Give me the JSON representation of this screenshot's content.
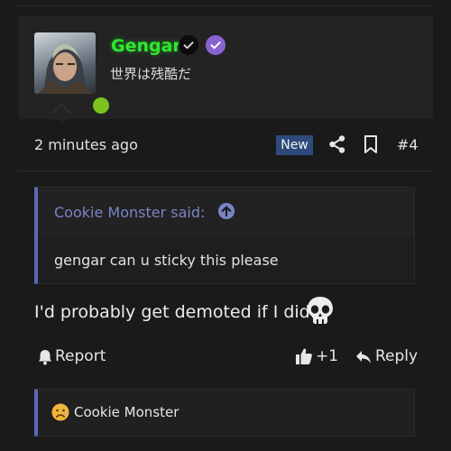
{
  "post": {
    "author": {
      "username": "Gengar",
      "title": "世界は残酷だ",
      "online_color": "#7cc21f",
      "username_color": "#2ee82e"
    },
    "date": "2 minutes ago",
    "new_badge": "New",
    "post_number": "#4",
    "quote": {
      "author_label": "Cookie Monster said:",
      "text": "gengar can u sticky this please"
    },
    "message": "I'd probably get demoted if I did.",
    "actions": {
      "report_label": "Report",
      "like_label": "+1",
      "reply_label": "Reply"
    },
    "reactions": {
      "emoji": "sad-face",
      "user": "Cookie Monster"
    }
  },
  "colors": {
    "background": "#1a1a1a",
    "card": "#232323",
    "quote_accent": "#5b68b8",
    "new_badge_bg": "#2d4a7a"
  }
}
